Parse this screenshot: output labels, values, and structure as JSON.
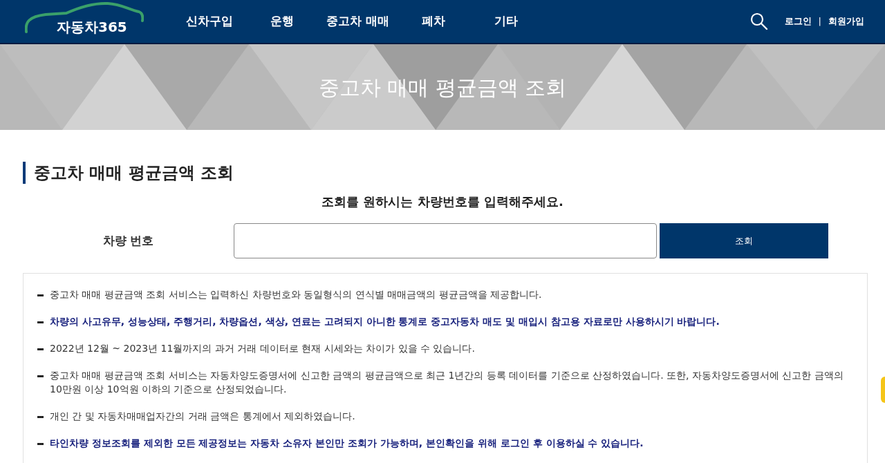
{
  "header": {
    "logo": "자동차365",
    "nav": [
      {
        "label": "신차구입"
      },
      {
        "label": "운행"
      },
      {
        "label": "중고차 매매"
      },
      {
        "label": "폐차"
      },
      {
        "label": "기타"
      }
    ],
    "links": [
      "로그인",
      "회원가입"
    ],
    "separator": "|"
  },
  "banner": {
    "title": "중고차 매매 평균금액 조회"
  },
  "section": {
    "title": "중고차 매매 평균금액 조회",
    "prompt": "조회를 원하시는 차량번호를 입력해주세요.",
    "field_label": "차량 번호",
    "button": "조회"
  },
  "notes": [
    {
      "kind": "normal",
      "text": "중고차 매매 평균금액 조회 서비스는 입력하신 차량번호와 동일형식의 연식별 매매금액의 평균금액을 제공합니다."
    },
    {
      "kind": "emphasis",
      "text": "차량의 사고유무, 성능상태, 주행거리, 차량옵션, 색상, 연료는 고려되지 아니한 통계로 중고자동차 매도 및 매입시 참고용 자료로만 사용하시기 바랍니다."
    },
    {
      "kind": "normal",
      "text": "2022년 12월 ~ 2023년 11월까지의 과거 거래 데이터로 현재 시세와는 차이가 있을 수 있습니다."
    },
    {
      "kind": "normal",
      "text": "중고차 매매 평균금액 조회 서비스는 자동차양도증명서에 신고한 금액의 평균금액으로 최근 1년간의 등록 데이터를 기준으로 산정하였습니다. 또한, 자동차양도증명서에 신고한 금액의 10만원 이상 10억원 이하의 기준으로 산정되었습니다."
    },
    {
      "kind": "normal",
      "text": "개인 간 및 자동차매매업자간의 거래 금액은 통계에서 제외하였습니다."
    },
    {
      "kind": "emphasis",
      "text": "타인차량 정보조회를 제외한 모든 제공정보는 자동차 소유자 본인만 조회가 가능하며, 본인확인을 위해 로그인 후 이용하실 수 있습니다."
    }
  ]
}
